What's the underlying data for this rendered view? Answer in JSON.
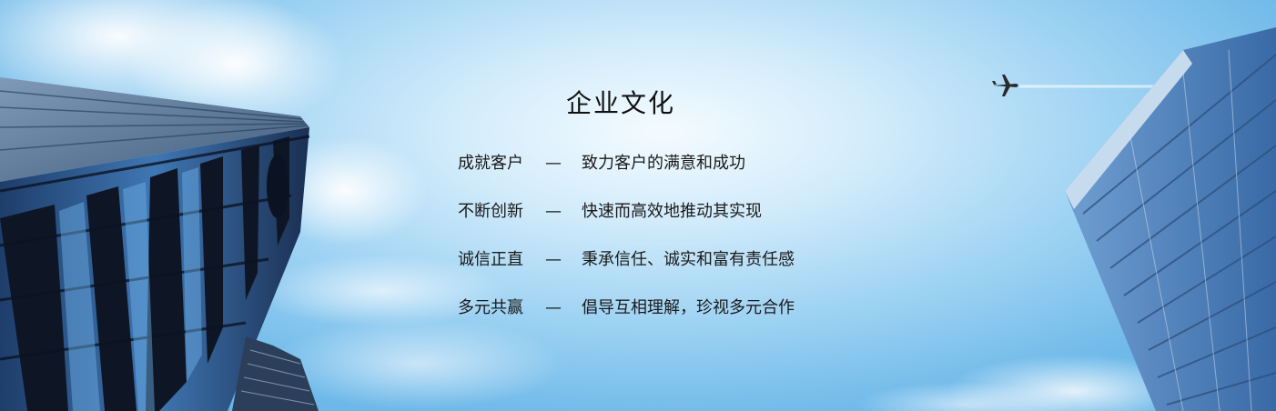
{
  "banner": {
    "title": "企业文化",
    "values": [
      {
        "key": "成就客户",
        "dash": "—",
        "desc": "致力客户的满意和成功"
      },
      {
        "key": "不断创新",
        "dash": "—",
        "desc": "快速而高效地推动其实现"
      },
      {
        "key": "诚信正直",
        "dash": "—",
        "desc": "秉承信任、诚实和富有责任感"
      },
      {
        "key": "多元共赢",
        "dash": "—",
        "desc": "倡导互相理解，珍视多元合作"
      }
    ]
  }
}
